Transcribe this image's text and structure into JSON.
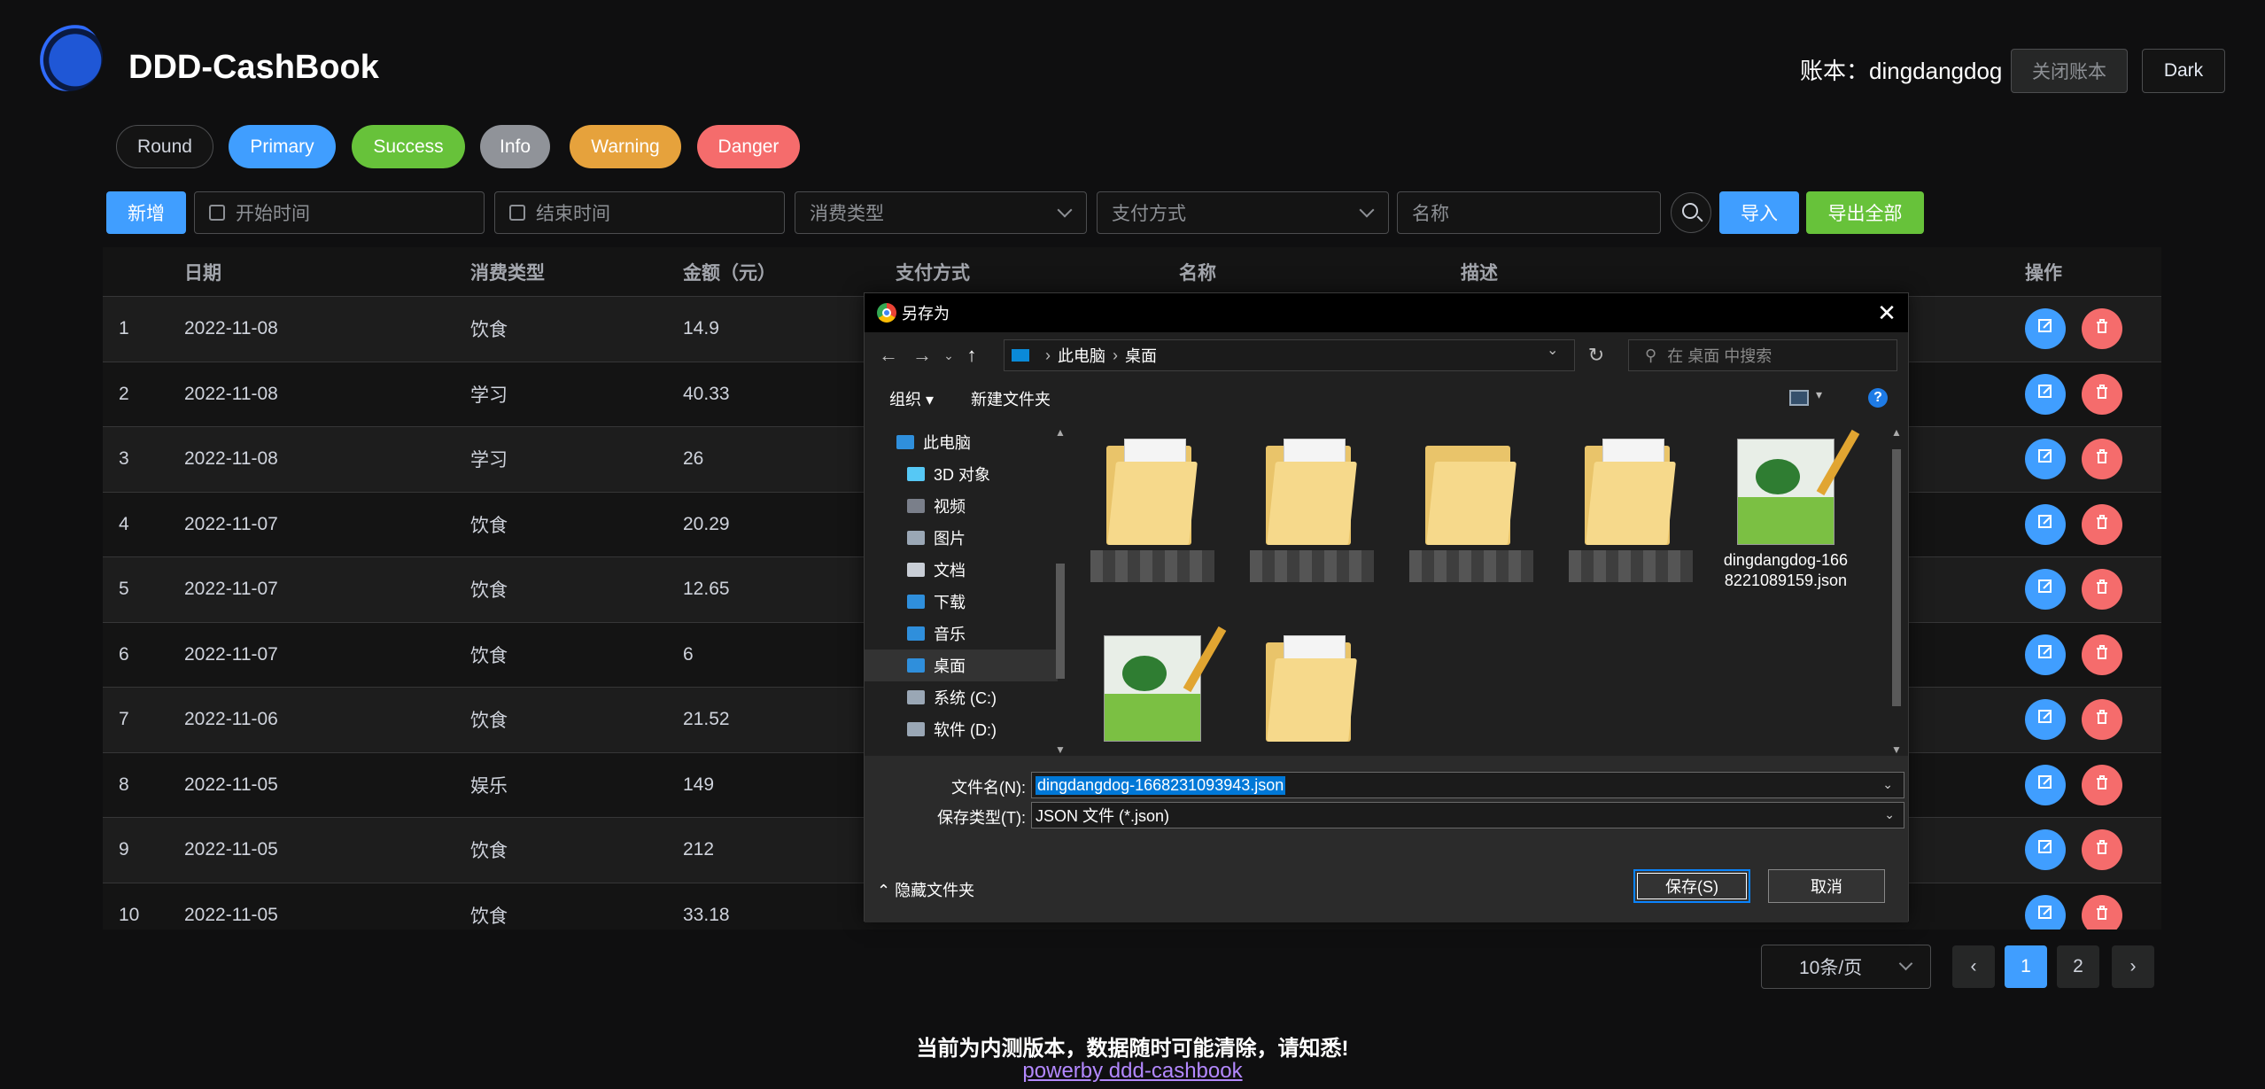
{
  "header": {
    "title": "DDD-CashBook",
    "account": "账本：dingdangdog",
    "close_book": "关闭账本",
    "dark": "Dark"
  },
  "pills": [
    {
      "label": "Round",
      "color": "#141414"
    },
    {
      "label": "Primary",
      "color": "#409eff"
    },
    {
      "label": "Success",
      "color": "#67c23a"
    },
    {
      "label": "Info",
      "color": "#909399"
    },
    {
      "label": "Warning",
      "color": "#e6a23c"
    },
    {
      "label": "Danger",
      "color": "#f56c6c"
    }
  ],
  "toolbar": {
    "add": "新增",
    "start_time": "开始时间",
    "end_time": "结束时间",
    "type": "消费类型",
    "payment": "支付方式",
    "name": "名称",
    "import": "导入",
    "export_all": "导出全部"
  },
  "table": {
    "headers": [
      "",
      "日期",
      "消费类型",
      "金额（元）",
      "支付方式",
      "名称",
      "描述",
      "操作"
    ],
    "rows": [
      [
        "1",
        "2022-11-08",
        "饮食",
        "14.9"
      ],
      [
        "2",
        "2022-11-08",
        "学习",
        "40.33"
      ],
      [
        "3",
        "2022-11-08",
        "学习",
        "26"
      ],
      [
        "4",
        "2022-11-07",
        "饮食",
        "20.29"
      ],
      [
        "5",
        "2022-11-07",
        "饮食",
        "12.65"
      ],
      [
        "6",
        "2022-11-07",
        "饮食",
        "6"
      ],
      [
        "7",
        "2022-11-06",
        "饮食",
        "21.52"
      ],
      [
        "8",
        "2022-11-05",
        "娱乐",
        "149"
      ],
      [
        "9",
        "2022-11-05",
        "饮食",
        "212"
      ],
      [
        "10",
        "2022-11-05",
        "饮食",
        "33.18"
      ]
    ]
  },
  "pagination": {
    "page_size": "10条/页",
    "pages": [
      "1",
      "2"
    ],
    "prev": "‹",
    "next": "›"
  },
  "footer": {
    "note": "当前为内测版本，数据随时可能清除，请知悉!",
    "link": "powerby ddd-cashbook"
  },
  "dialog": {
    "title": "另存为",
    "path": [
      "此电脑",
      "桌面"
    ],
    "search_placeholder": "在 桌面 中搜索",
    "organize": "组织 ▾",
    "new_folder": "新建文件夹",
    "tree": [
      {
        "label": "此电脑",
        "color": "#2f8fdc"
      },
      {
        "label": "3D 对象",
        "color": "#56c8f5"
      },
      {
        "label": "视频",
        "color": "#7a7f8a"
      },
      {
        "label": "图片",
        "color": "#9aa7b5"
      },
      {
        "label": "文档",
        "color": "#c9ced6"
      },
      {
        "label": "下载",
        "color": "#2f8fdc"
      },
      {
        "label": "音乐",
        "color": "#2f8fdc"
      },
      {
        "label": "桌面",
        "color": "#2f8fdc"
      },
      {
        "label": "系统 (C:)",
        "color": "#9aa7b5"
      },
      {
        "label": "软件 (D:)",
        "color": "#9aa7b5"
      }
    ],
    "json_file_label": "dingdangdog-1668221089159.json",
    "filename_label": "文件名(N):",
    "filename_value": "dingdangdog-1668231093943.json",
    "filetype_label": "保存类型(T):",
    "filetype_value": "JSON 文件 (*.json)",
    "hide_folders": "隐藏文件夹",
    "save": "保存(S)",
    "cancel": "取消"
  }
}
